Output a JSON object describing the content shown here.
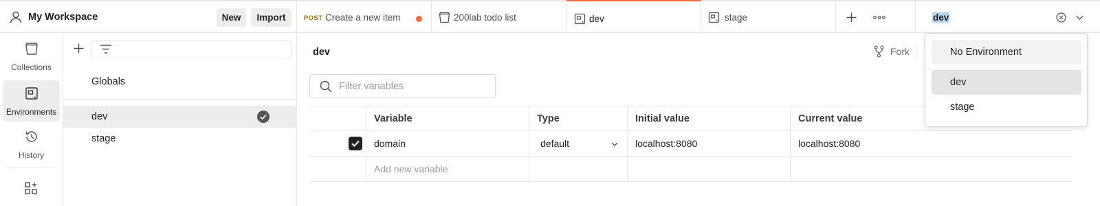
{
  "workspace": {
    "name": "My Workspace",
    "icon": "user-icon",
    "new_label": "New",
    "import_label": "Import"
  },
  "tabs": [
    {
      "method": "POST",
      "label": "Create a new item",
      "unsaved": true,
      "method_color": "#a66c00",
      "dot_color": "#f26b3a"
    },
    {
      "label": "200lab todo list",
      "icon": "collection-icon"
    },
    {
      "label": "dev",
      "icon": "environment-icon",
      "active": true
    },
    {
      "label": "stage",
      "icon": "environment-icon"
    }
  ],
  "env_selector": {
    "value": "dev"
  },
  "rail": {
    "collections": "Collections",
    "environments": "Environments",
    "history": "History"
  },
  "env_list": {
    "globals": "Globals",
    "items": [
      {
        "name": "dev",
        "active": true
      },
      {
        "name": "stage",
        "active": false
      }
    ]
  },
  "main": {
    "title": "dev",
    "fork_label": "Fork",
    "filter_placeholder": "Filter variables",
    "columns": {
      "variable": "Variable",
      "type": "Type",
      "initial": "Initial value",
      "current": "Current value"
    },
    "rows": [
      {
        "checked": true,
        "variable": "domain",
        "type": "default",
        "initial": "localhost:8080",
        "current": "localhost:8080"
      }
    ],
    "add_placeholder": "Add new variable"
  },
  "dropdown": {
    "options": [
      "No Environment",
      "dev",
      "stage"
    ],
    "selected": "dev"
  },
  "colors": {
    "accent": "#f26b3a",
    "selection": "#b8d4f5"
  }
}
